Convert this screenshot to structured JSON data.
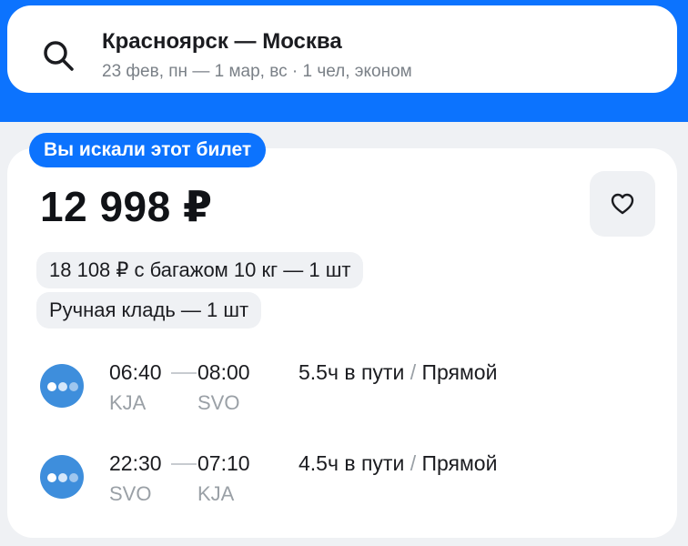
{
  "search": {
    "route": "Красноярск — Москва",
    "details": "23 фев, пн — 1 мар, вс · 1 чел, эконом"
  },
  "card": {
    "badge": "Вы искали этот билет",
    "price": "12 998 ₽",
    "chips": [
      "18 108 ₽ с багажом 10 кг — 1 шт",
      "Ручная кладь — 1 шт"
    ]
  },
  "segments": [
    {
      "dep_time": "06:40",
      "arr_time": "08:00",
      "dep_code": "KJA",
      "arr_code": "SVO",
      "duration": "5.5ч в пути",
      "separator": "/",
      "type": "Прямой"
    },
    {
      "dep_time": "22:30",
      "arr_time": "07:10",
      "dep_code": "SVO",
      "arr_code": "KJA",
      "duration": "4.5ч в пути",
      "separator": "/",
      "type": "Прямой"
    }
  ],
  "colors": {
    "accent": "#0c73fe",
    "airline": "#3e8edc"
  },
  "icons": {
    "search": "search-icon",
    "favorite": "heart-icon",
    "airline": "airline-logo-icon"
  }
}
